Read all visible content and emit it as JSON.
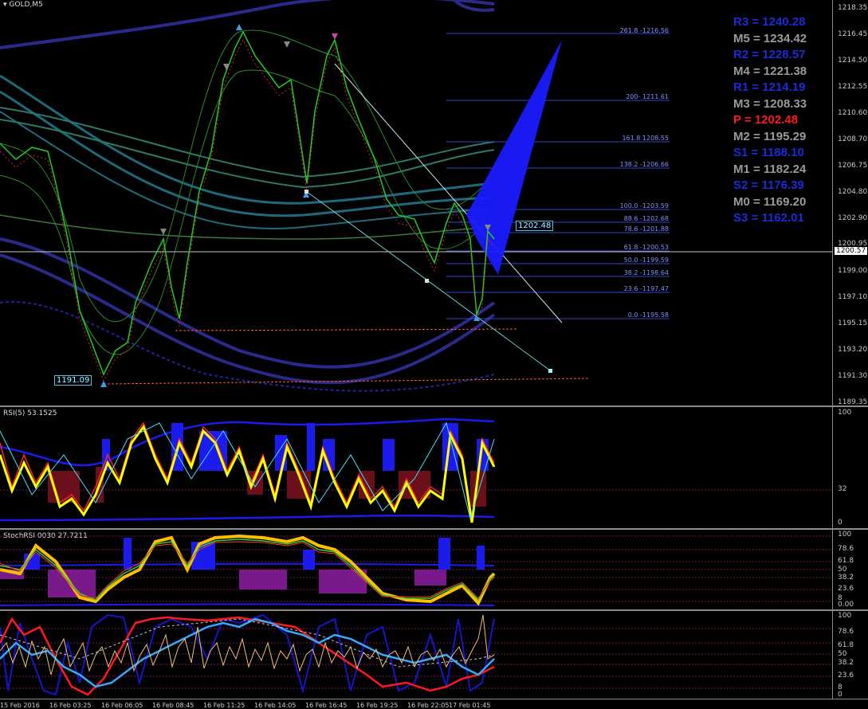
{
  "window": {
    "title": "GOLD,M5",
    "menu_icon": "triangle-down-icon"
  },
  "main": {
    "price_scale": [
      "1218.35",
      "1216.45",
      "1214.50",
      "1212.55",
      "1210.60",
      "1208.70",
      "1206.75",
      "1204.80",
      "1202.90",
      "1200.95",
      "1199.00",
      "1197.10",
      "1195.15",
      "1193.20",
      "1191.30",
      "1189.35"
    ],
    "current_price": "1200.57",
    "fib_levels": [
      "261.8 -1216.56",
      "200- 1211.61",
      "161.8 1208.55",
      "138.2 -1206.66",
      "100.0 -1203.59",
      "88.6 -1202.68",
      "78.6 -1201.88",
      "61.8 -1200.53",
      "50.0 -1199.59",
      "38.2 -1198.64",
      "23.6 -1197.47",
      "0.0 -1195.58"
    ],
    "marker_low": "1191.09",
    "marker_high": "1202.48",
    "pivots": [
      {
        "label": "R3 = 1240.28",
        "color": "#1c2bd8"
      },
      {
        "label": "M5 = 1234.42",
        "color": "#9a9a9a"
      },
      {
        "label": "R2 = 1228.57",
        "color": "#1c2bd8"
      },
      {
        "label": "M4 = 1221.38",
        "color": "#9a9a9a"
      },
      {
        "label": "R1 = 1214.19",
        "color": "#1c2bd8"
      },
      {
        "label": "M3 = 1208.33",
        "color": "#9a9a9a"
      },
      {
        "label": "P   = 1202.48",
        "color": "#ff1a1a"
      },
      {
        "label": "M2 = 1195.29",
        "color": "#9a9a9a"
      },
      {
        "label": "S1 = 1188.10",
        "color": "#1c2bd8"
      },
      {
        "label": "M1 = 1182.24",
        "color": "#9a9a9a"
      },
      {
        "label": "S2 = 1176.39",
        "color": "#1c2bd8"
      },
      {
        "label": "M0 = 1169.20",
        "color": "#9a9a9a"
      },
      {
        "label": "S3 = 1162.01",
        "color": "#1c2bd8"
      }
    ]
  },
  "rsi": {
    "title": "RSI(5) 53.1525",
    "scale": [
      "100",
      "32",
      "0"
    ]
  },
  "stoch": {
    "title": "StochRSI  0030 27.7211",
    "scale": [
      "100",
      "78.6",
      "61.8",
      "50",
      "38.2",
      "23.6",
      "8",
      "0.00"
    ]
  },
  "osc3": {
    "scale": [
      "100",
      "78.6",
      "61.8",
      "50",
      "38.2",
      "23.6",
      "8",
      "0"
    ]
  },
  "time_axis": [
    "15 Feb 2016",
    "16 Feb 03:25",
    "16 Feb 06:05",
    "16 Feb 08:45",
    "16 Feb 11:25",
    "16 Feb 14:05",
    "16 Feb 16:45",
    "16 Feb 19:25",
    "16 Feb 22:05",
    "17 Feb 01:45"
  ]
}
